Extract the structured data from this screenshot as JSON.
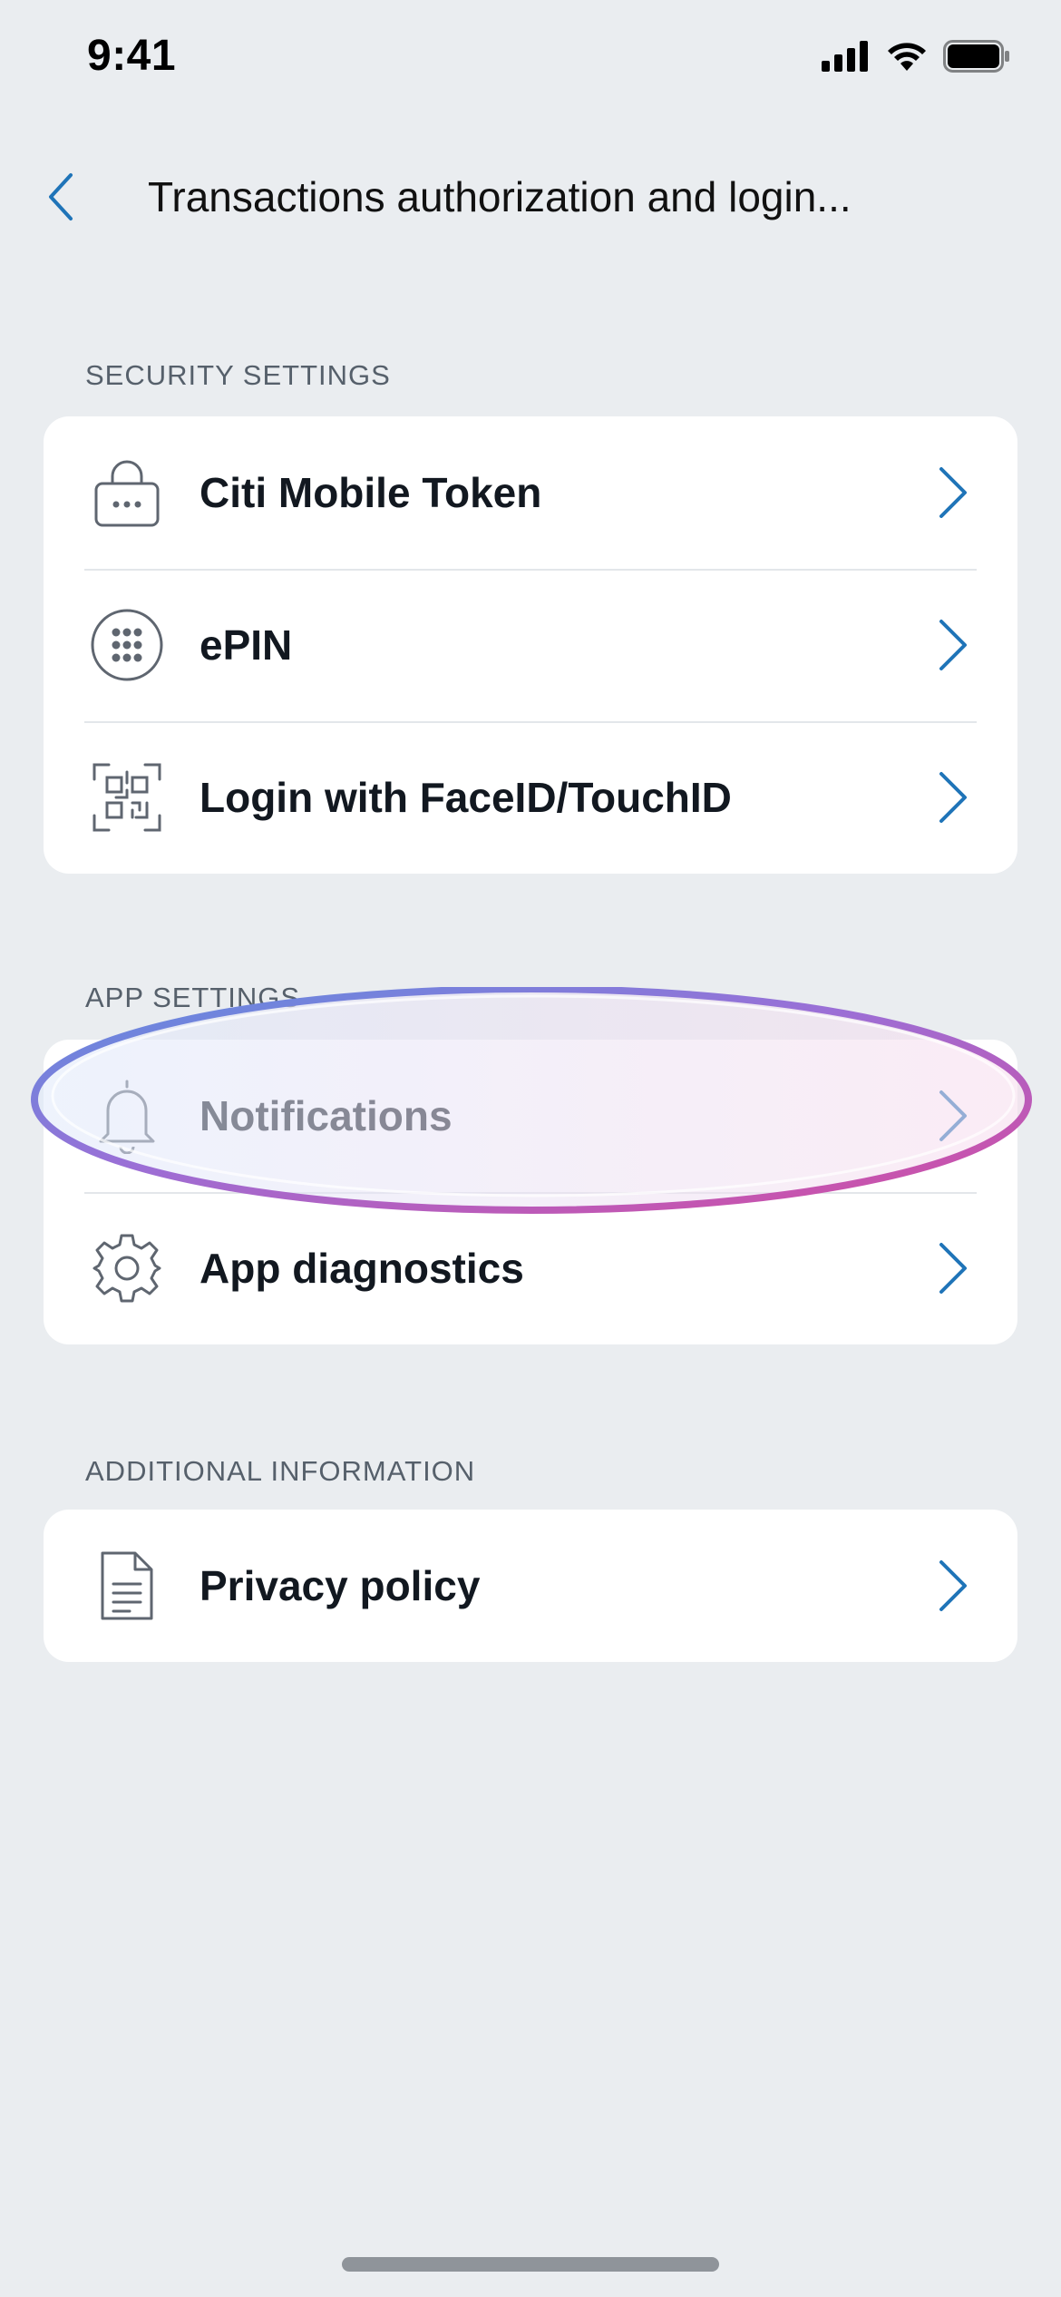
{
  "status_bar": {
    "time": "9:41",
    "icons": [
      "cellular-signal-icon",
      "wifi-icon",
      "battery-icon"
    ]
  },
  "nav": {
    "back_icon": "chevron-left-icon",
    "title": "Transactions authorization and login..."
  },
  "sections": {
    "security": {
      "label": "SECURITY SETTINGS",
      "items": [
        {
          "label": "Citi Mobile Token",
          "icon": "lock-icon"
        },
        {
          "label": "ePIN",
          "icon": "keypad-icon"
        },
        {
          "label": "Login with FaceID/TouchID",
          "icon": "qr-scan-icon"
        }
      ]
    },
    "app": {
      "label": "APP SETTINGS",
      "items": [
        {
          "label": "Notifications",
          "icon": "bell-icon"
        },
        {
          "label": "App diagnostics",
          "icon": "gear-icon"
        }
      ]
    },
    "additional": {
      "label": "ADDITIONAL INFORMATION",
      "items": [
        {
          "label": "Privacy policy",
          "icon": "document-icon"
        }
      ]
    }
  },
  "colors": {
    "background": "#eaedf0",
    "card": "#ffffff",
    "accent_chevron": "#1f74b8",
    "section_label": "#56606b",
    "highlight_gradient": [
      "#5b8fe0",
      "#9b6fd6",
      "#d64aa0"
    ]
  }
}
